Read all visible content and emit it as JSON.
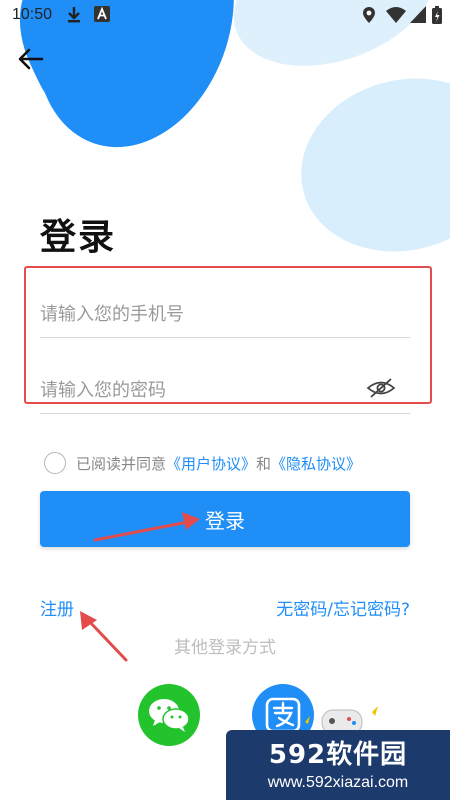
{
  "status_bar": {
    "time": "10:50",
    "icons": [
      "download-icon",
      "a-badge-icon",
      "location-icon",
      "wifi-icon",
      "signal-icon",
      "battery-icon"
    ]
  },
  "header": {
    "back_icon": "arrow-left-icon"
  },
  "title": "登录",
  "phone": {
    "placeholder": "请输入您的手机号",
    "value": ""
  },
  "password": {
    "placeholder": "请输入您的密码",
    "value": "",
    "toggle_icon": "eye-closed-icon"
  },
  "agreement": {
    "checked": false,
    "prefix": "已阅读并同意",
    "user_agreement": "《用户协议》",
    "and": "和",
    "privacy_agreement": "《隐私协议》"
  },
  "login_button": "登录",
  "register_link": "注册",
  "forgot_link": "无密码/忘记密码?",
  "other_methods_label": "其他登录方式",
  "social": [
    {
      "name": "wechat",
      "icon": "wechat-icon",
      "color": "#22c32c"
    },
    {
      "name": "alipay",
      "icon": "alipay-icon",
      "color": "#1f8ef7"
    }
  ],
  "watermark": {
    "brand": "592软件园",
    "url": "www.592xiazai.com"
  },
  "colors": {
    "accent": "#1f8ef7",
    "highlight": "#e24c4c",
    "wechat": "#22c32c",
    "watermark_bg": "#1d3a6d"
  }
}
